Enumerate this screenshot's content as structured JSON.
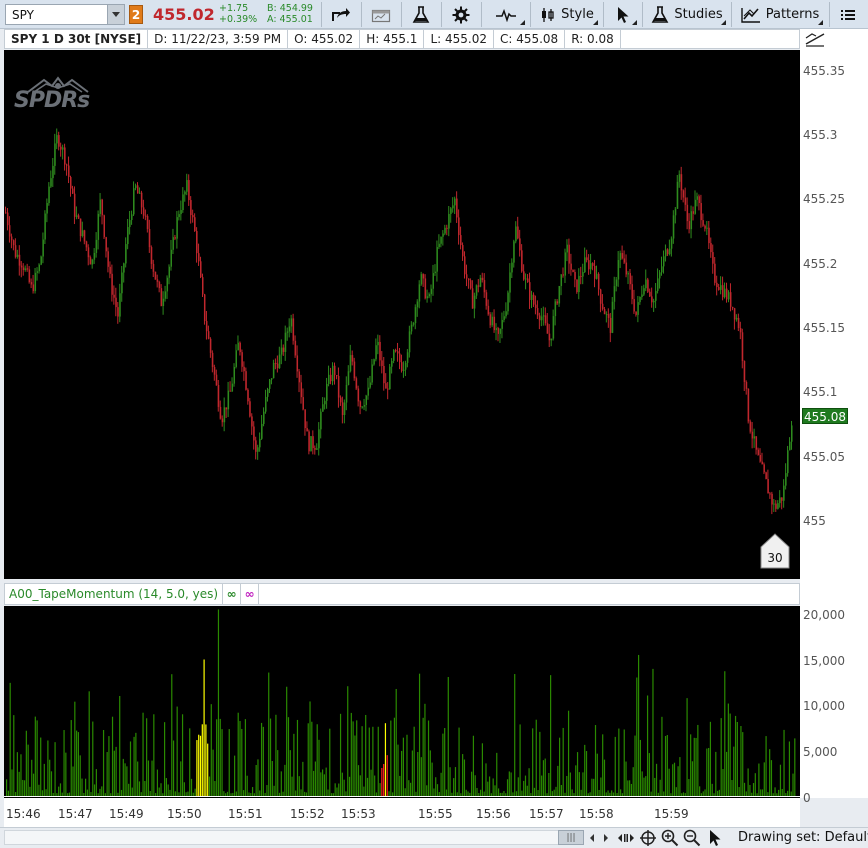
{
  "toolbar": {
    "symbol": "SPY",
    "link_badge": "2",
    "last_price": "455.02",
    "net_change": "+1.75",
    "net_change_pct": "+0.39%",
    "bid": "B: 454.99",
    "ask": "A: 455.01",
    "style_label": "Style",
    "studies_label": "Studies",
    "patterns_label": "Patterns",
    "icons": [
      "share-icon",
      "chart-window-icon",
      "flask-icon",
      "gear-icon",
      "wave-icon",
      "candle-style-icon",
      "cursor-icon",
      "studies-flask-icon",
      "patterns-icon",
      "menu-icon"
    ]
  },
  "chart_header": {
    "title": "SPY 1 D 30t [NYSE]",
    "date": "D: 11/22/23, 3:59 PM",
    "open": "O: 455.02",
    "high": "H: 455.1",
    "low": "L: 455.02",
    "close": "C: 455.08",
    "range": "R: 0.08"
  },
  "logo": {
    "text": "SPDRs"
  },
  "price_axis": {
    "labels": [
      "455.35",
      "455.3",
      "455.25",
      "455.2",
      "455.15",
      "455.1",
      "455.05",
      "455"
    ],
    "current_price": "455.08",
    "tick_badge": "30"
  },
  "study": {
    "name": "A00_TapeMomentum (14, 5.0, yes)",
    "link1": "∞",
    "link2": "∞"
  },
  "volume_axis": {
    "labels": [
      "20,000",
      "15,000",
      "10,000",
      "5,000",
      "0"
    ]
  },
  "time_axis": {
    "labels": [
      "15:46",
      "15:47",
      "15:49",
      "15:50",
      "15:51",
      "15:52",
      "15:53",
      "15:55",
      "15:56",
      "15:57",
      "15:58",
      "15:59"
    ]
  },
  "bottom_bar": {
    "drawing_set": "Drawing set: Default"
  },
  "colors": {
    "up": "#2e8b1e",
    "down": "#c0272d",
    "volume_up": "#2a8a00",
    "volume_high": "#ffff00",
    "volume_red": "#ff2020",
    "price_badge": "#1f7a1f"
  },
  "chart_data": [
    {
      "type": "candlestick",
      "title": "SPY 1 D 30t [NYSE]",
      "y_axis_ticks": [
        455,
        455.05,
        455.1,
        455.15,
        455.2,
        455.25,
        455.3,
        455.35
      ],
      "ylim": [
        454.97,
        455.38
      ],
      "x_axis_ticks": [
        "15:46",
        "15:47",
        "15:49",
        "15:50",
        "15:51",
        "15:52",
        "15:53",
        "15:55",
        "15:56",
        "15:57",
        "15:58",
        "15:59"
      ],
      "last": 455.08,
      "close_path": [
        455.24,
        455.21,
        455.2,
        455.18,
        455.2,
        455.26,
        455.3,
        455.28,
        455.24,
        455.22,
        455.2,
        455.25,
        455.19,
        455.16,
        455.22,
        455.26,
        455.24,
        455.2,
        455.17,
        455.2,
        455.24,
        455.26,
        455.22,
        455.16,
        455.12,
        455.08,
        455.1,
        455.14,
        455.1,
        455.05,
        455.09,
        455.12,
        455.13,
        455.16,
        455.11,
        455.06,
        455.06,
        455.1,
        455.12,
        455.08,
        455.13,
        455.09,
        455.1,
        455.14,
        455.1,
        455.13,
        455.12,
        455.15,
        455.19,
        455.17,
        455.21,
        455.23,
        455.25,
        455.2,
        455.17,
        455.19,
        455.16,
        455.14,
        455.17,
        455.23,
        455.19,
        455.17,
        455.16,
        455.14,
        455.18,
        455.21,
        455.18,
        455.2,
        455.2,
        455.17,
        455.15,
        455.21,
        455.19,
        455.16,
        455.19,
        455.17,
        455.2,
        455.22,
        455.27,
        455.23,
        455.25,
        455.23,
        455.19,
        455.18,
        455.17,
        455.15,
        455.08,
        455.05,
        455.03,
        455.01,
        455.02,
        455.08
      ]
    },
    {
      "type": "bar",
      "title": "A00_TapeMomentum (14, 5.0, yes)",
      "ylim": [
        0,
        21000
      ],
      "y_axis_ticks": [
        0,
        5000,
        10000,
        15000,
        20000
      ],
      "series": [
        {
          "name": "",
          "color": "#2a8a00"
        }
      ],
      "peaks": [
        {
          "time": "15:50",
          "value": 20500,
          "color": "#2a8a00"
        },
        {
          "time": "15:50",
          "value": 15000,
          "color": "#ffff00"
        },
        {
          "time": "15:53",
          "value": 8000,
          "color": "#ffff00"
        },
        {
          "time": "15:59",
          "value": 15500,
          "color": "#2a8a00"
        }
      ]
    }
  ]
}
